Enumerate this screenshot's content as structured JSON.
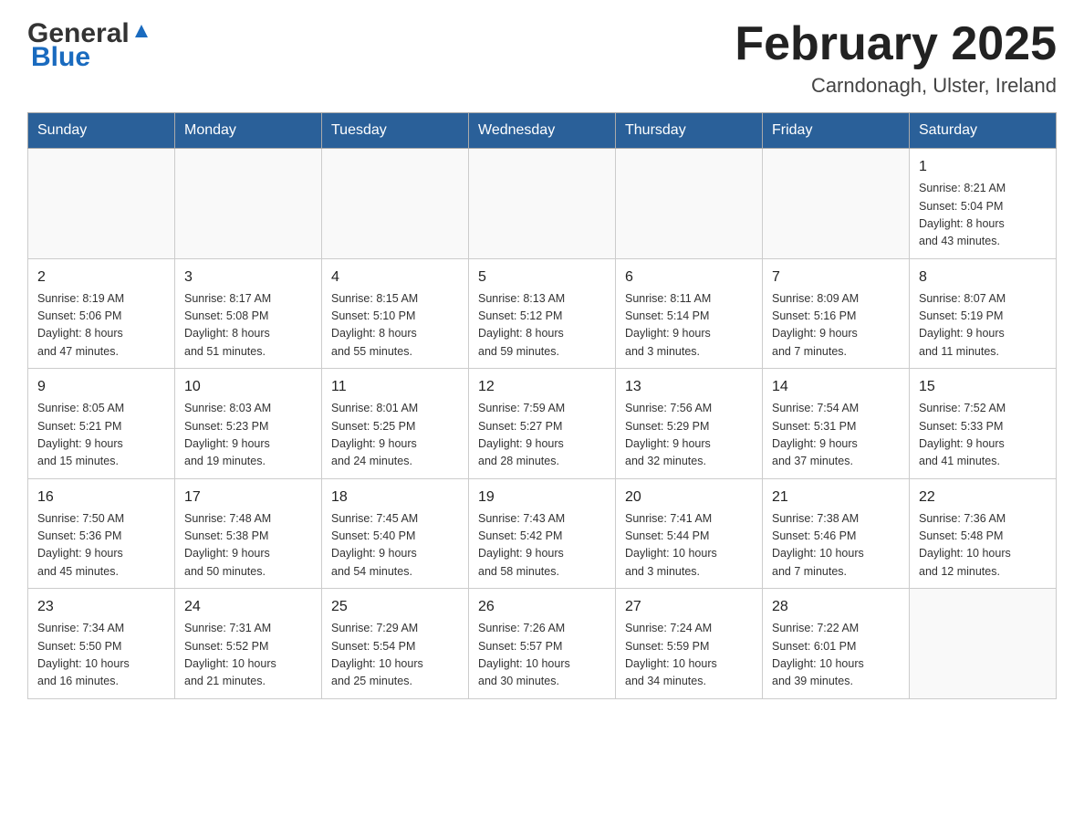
{
  "header": {
    "logo_general": "General",
    "logo_blue": "Blue",
    "title": "February 2025",
    "subtitle": "Carndonagh, Ulster, Ireland"
  },
  "days_of_week": [
    "Sunday",
    "Monday",
    "Tuesday",
    "Wednesday",
    "Thursday",
    "Friday",
    "Saturday"
  ],
  "weeks": [
    [
      {
        "day": "",
        "info": ""
      },
      {
        "day": "",
        "info": ""
      },
      {
        "day": "",
        "info": ""
      },
      {
        "day": "",
        "info": ""
      },
      {
        "day": "",
        "info": ""
      },
      {
        "day": "",
        "info": ""
      },
      {
        "day": "1",
        "info": "Sunrise: 8:21 AM\nSunset: 5:04 PM\nDaylight: 8 hours\nand 43 minutes."
      }
    ],
    [
      {
        "day": "2",
        "info": "Sunrise: 8:19 AM\nSunset: 5:06 PM\nDaylight: 8 hours\nand 47 minutes."
      },
      {
        "day": "3",
        "info": "Sunrise: 8:17 AM\nSunset: 5:08 PM\nDaylight: 8 hours\nand 51 minutes."
      },
      {
        "day": "4",
        "info": "Sunrise: 8:15 AM\nSunset: 5:10 PM\nDaylight: 8 hours\nand 55 minutes."
      },
      {
        "day": "5",
        "info": "Sunrise: 8:13 AM\nSunset: 5:12 PM\nDaylight: 8 hours\nand 59 minutes."
      },
      {
        "day": "6",
        "info": "Sunrise: 8:11 AM\nSunset: 5:14 PM\nDaylight: 9 hours\nand 3 minutes."
      },
      {
        "day": "7",
        "info": "Sunrise: 8:09 AM\nSunset: 5:16 PM\nDaylight: 9 hours\nand 7 minutes."
      },
      {
        "day": "8",
        "info": "Sunrise: 8:07 AM\nSunset: 5:19 PM\nDaylight: 9 hours\nand 11 minutes."
      }
    ],
    [
      {
        "day": "9",
        "info": "Sunrise: 8:05 AM\nSunset: 5:21 PM\nDaylight: 9 hours\nand 15 minutes."
      },
      {
        "day": "10",
        "info": "Sunrise: 8:03 AM\nSunset: 5:23 PM\nDaylight: 9 hours\nand 19 minutes."
      },
      {
        "day": "11",
        "info": "Sunrise: 8:01 AM\nSunset: 5:25 PM\nDaylight: 9 hours\nand 24 minutes."
      },
      {
        "day": "12",
        "info": "Sunrise: 7:59 AM\nSunset: 5:27 PM\nDaylight: 9 hours\nand 28 minutes."
      },
      {
        "day": "13",
        "info": "Sunrise: 7:56 AM\nSunset: 5:29 PM\nDaylight: 9 hours\nand 32 minutes."
      },
      {
        "day": "14",
        "info": "Sunrise: 7:54 AM\nSunset: 5:31 PM\nDaylight: 9 hours\nand 37 minutes."
      },
      {
        "day": "15",
        "info": "Sunrise: 7:52 AM\nSunset: 5:33 PM\nDaylight: 9 hours\nand 41 minutes."
      }
    ],
    [
      {
        "day": "16",
        "info": "Sunrise: 7:50 AM\nSunset: 5:36 PM\nDaylight: 9 hours\nand 45 minutes."
      },
      {
        "day": "17",
        "info": "Sunrise: 7:48 AM\nSunset: 5:38 PM\nDaylight: 9 hours\nand 50 minutes."
      },
      {
        "day": "18",
        "info": "Sunrise: 7:45 AM\nSunset: 5:40 PM\nDaylight: 9 hours\nand 54 minutes."
      },
      {
        "day": "19",
        "info": "Sunrise: 7:43 AM\nSunset: 5:42 PM\nDaylight: 9 hours\nand 58 minutes."
      },
      {
        "day": "20",
        "info": "Sunrise: 7:41 AM\nSunset: 5:44 PM\nDaylight: 10 hours\nand 3 minutes."
      },
      {
        "day": "21",
        "info": "Sunrise: 7:38 AM\nSunset: 5:46 PM\nDaylight: 10 hours\nand 7 minutes."
      },
      {
        "day": "22",
        "info": "Sunrise: 7:36 AM\nSunset: 5:48 PM\nDaylight: 10 hours\nand 12 minutes."
      }
    ],
    [
      {
        "day": "23",
        "info": "Sunrise: 7:34 AM\nSunset: 5:50 PM\nDaylight: 10 hours\nand 16 minutes."
      },
      {
        "day": "24",
        "info": "Sunrise: 7:31 AM\nSunset: 5:52 PM\nDaylight: 10 hours\nand 21 minutes."
      },
      {
        "day": "25",
        "info": "Sunrise: 7:29 AM\nSunset: 5:54 PM\nDaylight: 10 hours\nand 25 minutes."
      },
      {
        "day": "26",
        "info": "Sunrise: 7:26 AM\nSunset: 5:57 PM\nDaylight: 10 hours\nand 30 minutes."
      },
      {
        "day": "27",
        "info": "Sunrise: 7:24 AM\nSunset: 5:59 PM\nDaylight: 10 hours\nand 34 minutes."
      },
      {
        "day": "28",
        "info": "Sunrise: 7:22 AM\nSunset: 6:01 PM\nDaylight: 10 hours\nand 39 minutes."
      },
      {
        "day": "",
        "info": ""
      }
    ]
  ]
}
